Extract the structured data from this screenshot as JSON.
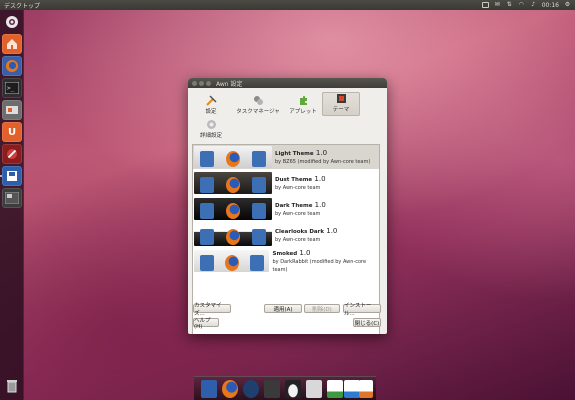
{
  "top_panel": {
    "title": "デスクトップ",
    "clock": "00:16"
  },
  "dialog": {
    "title": "Awn 設定",
    "toolbar": [
      {
        "label": "設定",
        "icon": "settings-tools-icon"
      },
      {
        "label": "タスクマネージャ",
        "icon": "task-manager-icon"
      },
      {
        "label": "アプレット",
        "icon": "applet-puzzle-icon"
      },
      {
        "label": "テーマ",
        "icon": "theme-icon",
        "active": true
      },
      {
        "label": "詳細設定",
        "icon": "advanced-settings-icon"
      }
    ],
    "themes": [
      {
        "name": "Light Theme",
        "version": "1.0",
        "author": "by BZ65 (modified by Awn-core team)",
        "selected": true,
        "style": "light"
      },
      {
        "name": "Dust Theme",
        "version": "1.0",
        "author": "by Awn-core team",
        "selected": false,
        "style": "dust"
      },
      {
        "name": "Dark Theme",
        "version": "1.0",
        "author": "by Awn-core team",
        "selected": false,
        "style": "dark"
      },
      {
        "name": "Clearlooks Dark",
        "version": "1.0",
        "author": "by Awn-core team",
        "selected": false,
        "style": "clear"
      },
      {
        "name": "Smoked",
        "version": "1.0",
        "author": "by DarkRabbit (modified by Awn-core team)",
        "selected": false,
        "style": "smoked"
      }
    ],
    "buttons": {
      "customize": "カスタマイズ...",
      "apply": "適用(A)",
      "delete": "削除(D)",
      "install": "インストール...",
      "help": "ヘルプ(H)",
      "close": "閉じる(C)"
    }
  },
  "colors": {
    "panel": "#3c3b37",
    "selection": "#d9d6cf",
    "ubuntu_orange": "#e95420"
  }
}
